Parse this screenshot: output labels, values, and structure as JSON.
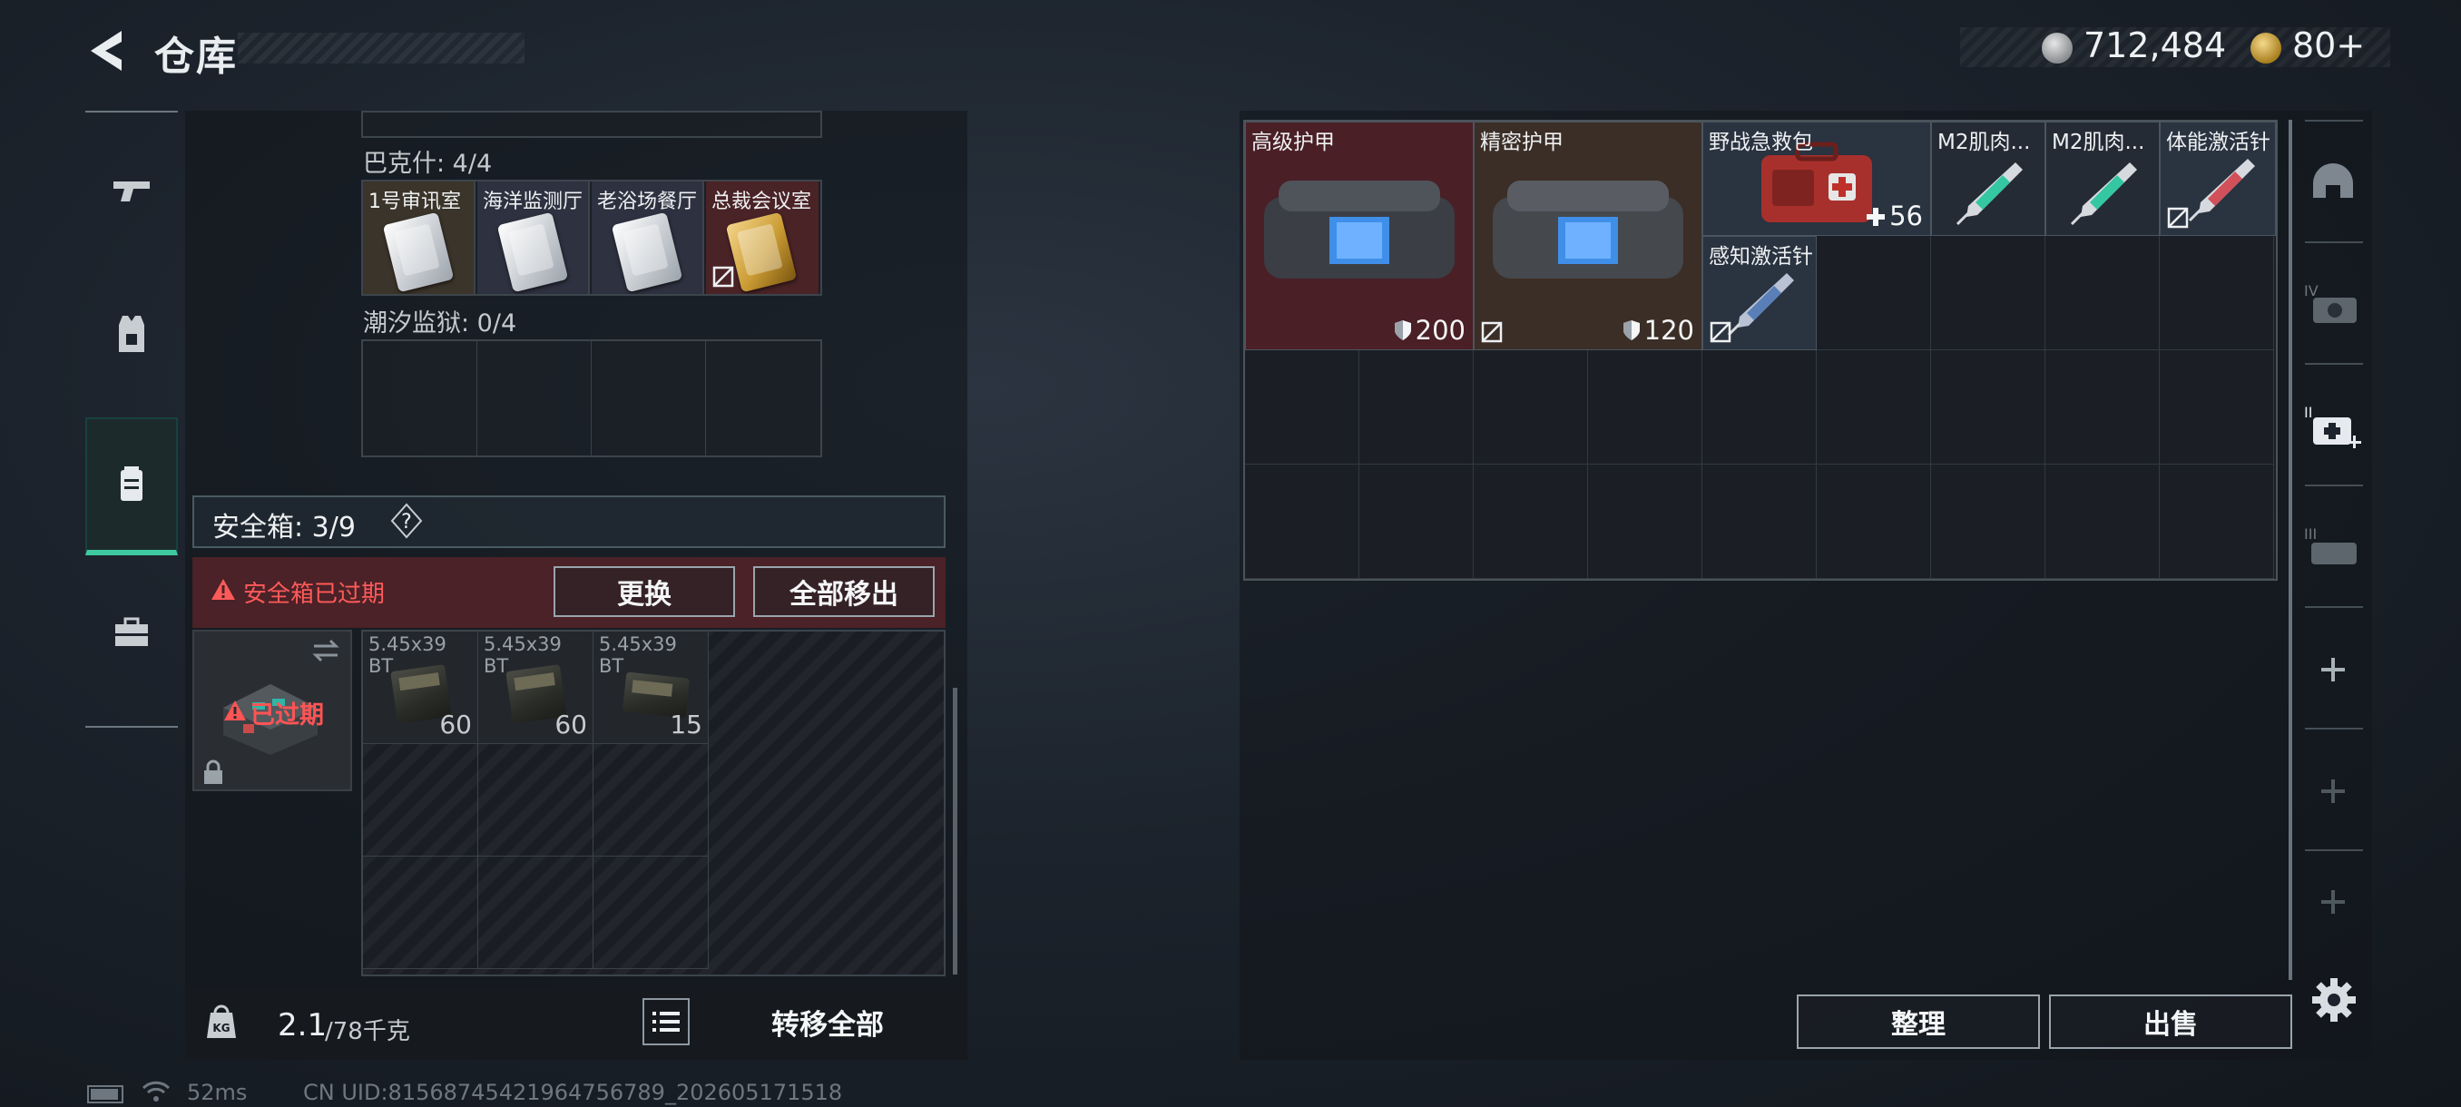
{
  "header": {
    "title": "仓库",
    "money": "712,484",
    "coins": "80+"
  },
  "nav": {
    "items": [
      "weapon",
      "armor-vest",
      "container",
      "toolbox"
    ],
    "active": "container"
  },
  "left": {
    "top_section_label": "巴克什: 4/4",
    "keycards": [
      {
        "name": "1号审讯室",
        "color": "silver",
        "no_trade": false
      },
      {
        "name": "海洋监测厅",
        "color": "silver",
        "no_trade": false
      },
      {
        "name": "老浴场餐厅",
        "color": "silver",
        "no_trade": false
      },
      {
        "name": "总裁会议室",
        "color": "gold",
        "no_trade": true
      }
    ],
    "second_section_label": "潮汐监狱: 0/4",
    "safe_label": "安全箱: 3/9",
    "help_glyph": "?",
    "expired_warning": "安全箱已过期",
    "replace_label": "更换",
    "remove_all_label": "全部移出",
    "expired_tag": "已过期",
    "ammo": [
      {
        "name": "5.45x39\nBT",
        "count": "60"
      },
      {
        "name": "5.45x39\nBT",
        "count": "60"
      },
      {
        "name": "5.45x39\nBT",
        "count": "15"
      }
    ],
    "weight_value": "2.1",
    "weight_cap": "/78千克",
    "transfer_all_label": "转移全部"
  },
  "right": {
    "items": [
      {
        "name": "高级护甲",
        "stat": "200",
        "stat_type": "durability",
        "no_trade": false,
        "bg": "#4a1f26"
      },
      {
        "name": "精密护甲",
        "stat": "120",
        "stat_type": "durability",
        "no_trade": true,
        "bg": "#3b2e26"
      },
      {
        "name": "野战急救包",
        "stat": "56",
        "stat_type": "heal",
        "no_trade": false,
        "bg": "#2a3340"
      },
      {
        "name": "M2肌肉...",
        "stat": "",
        "no_trade": false,
        "bg": "#242b35"
      },
      {
        "name": "M2肌肉...",
        "stat": "",
        "no_trade": false,
        "bg": "#242b35"
      },
      {
        "name": "体能激活针",
        "stat": "",
        "no_trade": true,
        "bg": "#2a3340"
      },
      {
        "name": "感知激活针",
        "stat": "",
        "no_trade": true,
        "bg": "#2a3340"
      }
    ],
    "tools": [
      "helmet-icon",
      "armor-iv-icon",
      "medkit-add-icon",
      "armor-iii-icon",
      "plus-icon",
      "plus-icon",
      "plus-icon"
    ],
    "sort_label": "整理",
    "sell_label": "出售"
  },
  "status": {
    "ping": "52ms",
    "uid": "CN UID:8156874542196475678​9_202605171518"
  },
  "colors": {
    "accent": "#3fc9a0",
    "danger": "#ff5a5a",
    "expired_bg": "#4a2227"
  }
}
